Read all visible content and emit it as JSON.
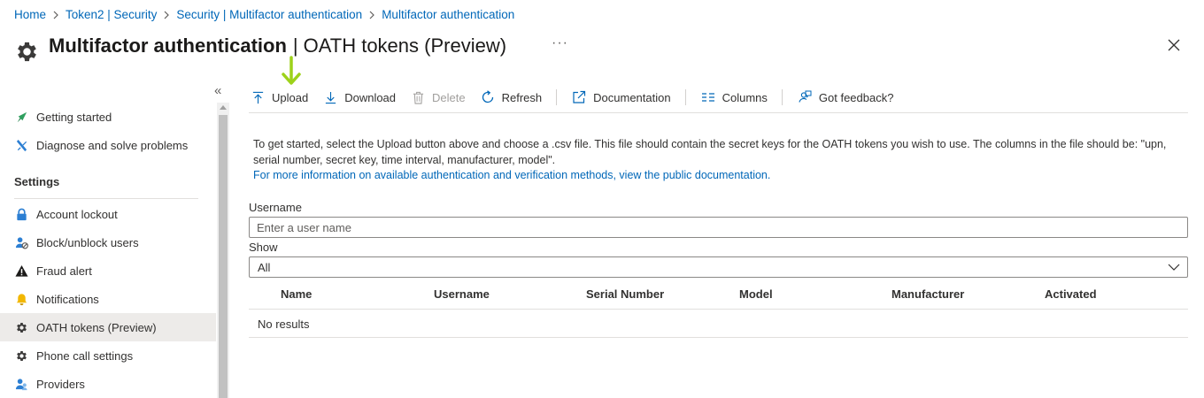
{
  "breadcrumb": [
    "Home",
    "Token2 | Security",
    "Security | Multifactor authentication",
    "Multifactor authentication"
  ],
  "header": {
    "title_bold": "Multifactor authentication",
    "title_separator": "|",
    "title_rest": "OATH tokens (Preview)",
    "more_label": "···"
  },
  "sidebar": {
    "collapse_label": "«",
    "top_items": [
      {
        "label": "Getting started",
        "icon": "rocket-icon"
      },
      {
        "label": "Diagnose and solve problems",
        "icon": "wrench-icon"
      }
    ],
    "section_title": "Settings",
    "items": [
      {
        "label": "Account lockout",
        "icon": "lock-icon"
      },
      {
        "label": "Block/unblock users",
        "icon": "user-block-icon"
      },
      {
        "label": "Fraud alert",
        "icon": "warning-icon"
      },
      {
        "label": "Notifications",
        "icon": "bell-icon"
      },
      {
        "label": "OATH tokens (Preview)",
        "icon": "gear-icon",
        "active": true
      },
      {
        "label": "Phone call settings",
        "icon": "gear-icon"
      },
      {
        "label": "Providers",
        "icon": "users-icon"
      }
    ]
  },
  "toolbar": {
    "upload": "Upload",
    "download": "Download",
    "delete": "Delete",
    "refresh": "Refresh",
    "documentation": "Documentation",
    "columns": "Columns",
    "feedback": "Got feedback?"
  },
  "info": {
    "line1": "To get started, select the Upload button above and choose a .csv file. This file should contain the secret keys for the OATH tokens you wish to use. The columns in the file should be: \"upn, serial number, secret key, time interval, manufacturer, model\".",
    "link": "For more information on available authentication and verification methods, view the public documentation."
  },
  "filters": {
    "username_label": "Username",
    "username_placeholder": "Enter a user name",
    "username_value": "",
    "show_label": "Show",
    "show_value": "All"
  },
  "table": {
    "columns": [
      "Name",
      "Username",
      "Serial Number",
      "Model",
      "Manufacturer",
      "Activated"
    ],
    "empty_text": "No results"
  },
  "colors": {
    "link": "#0067b8",
    "accent_green": "#9dd21a",
    "active_bg": "#edebe9"
  }
}
